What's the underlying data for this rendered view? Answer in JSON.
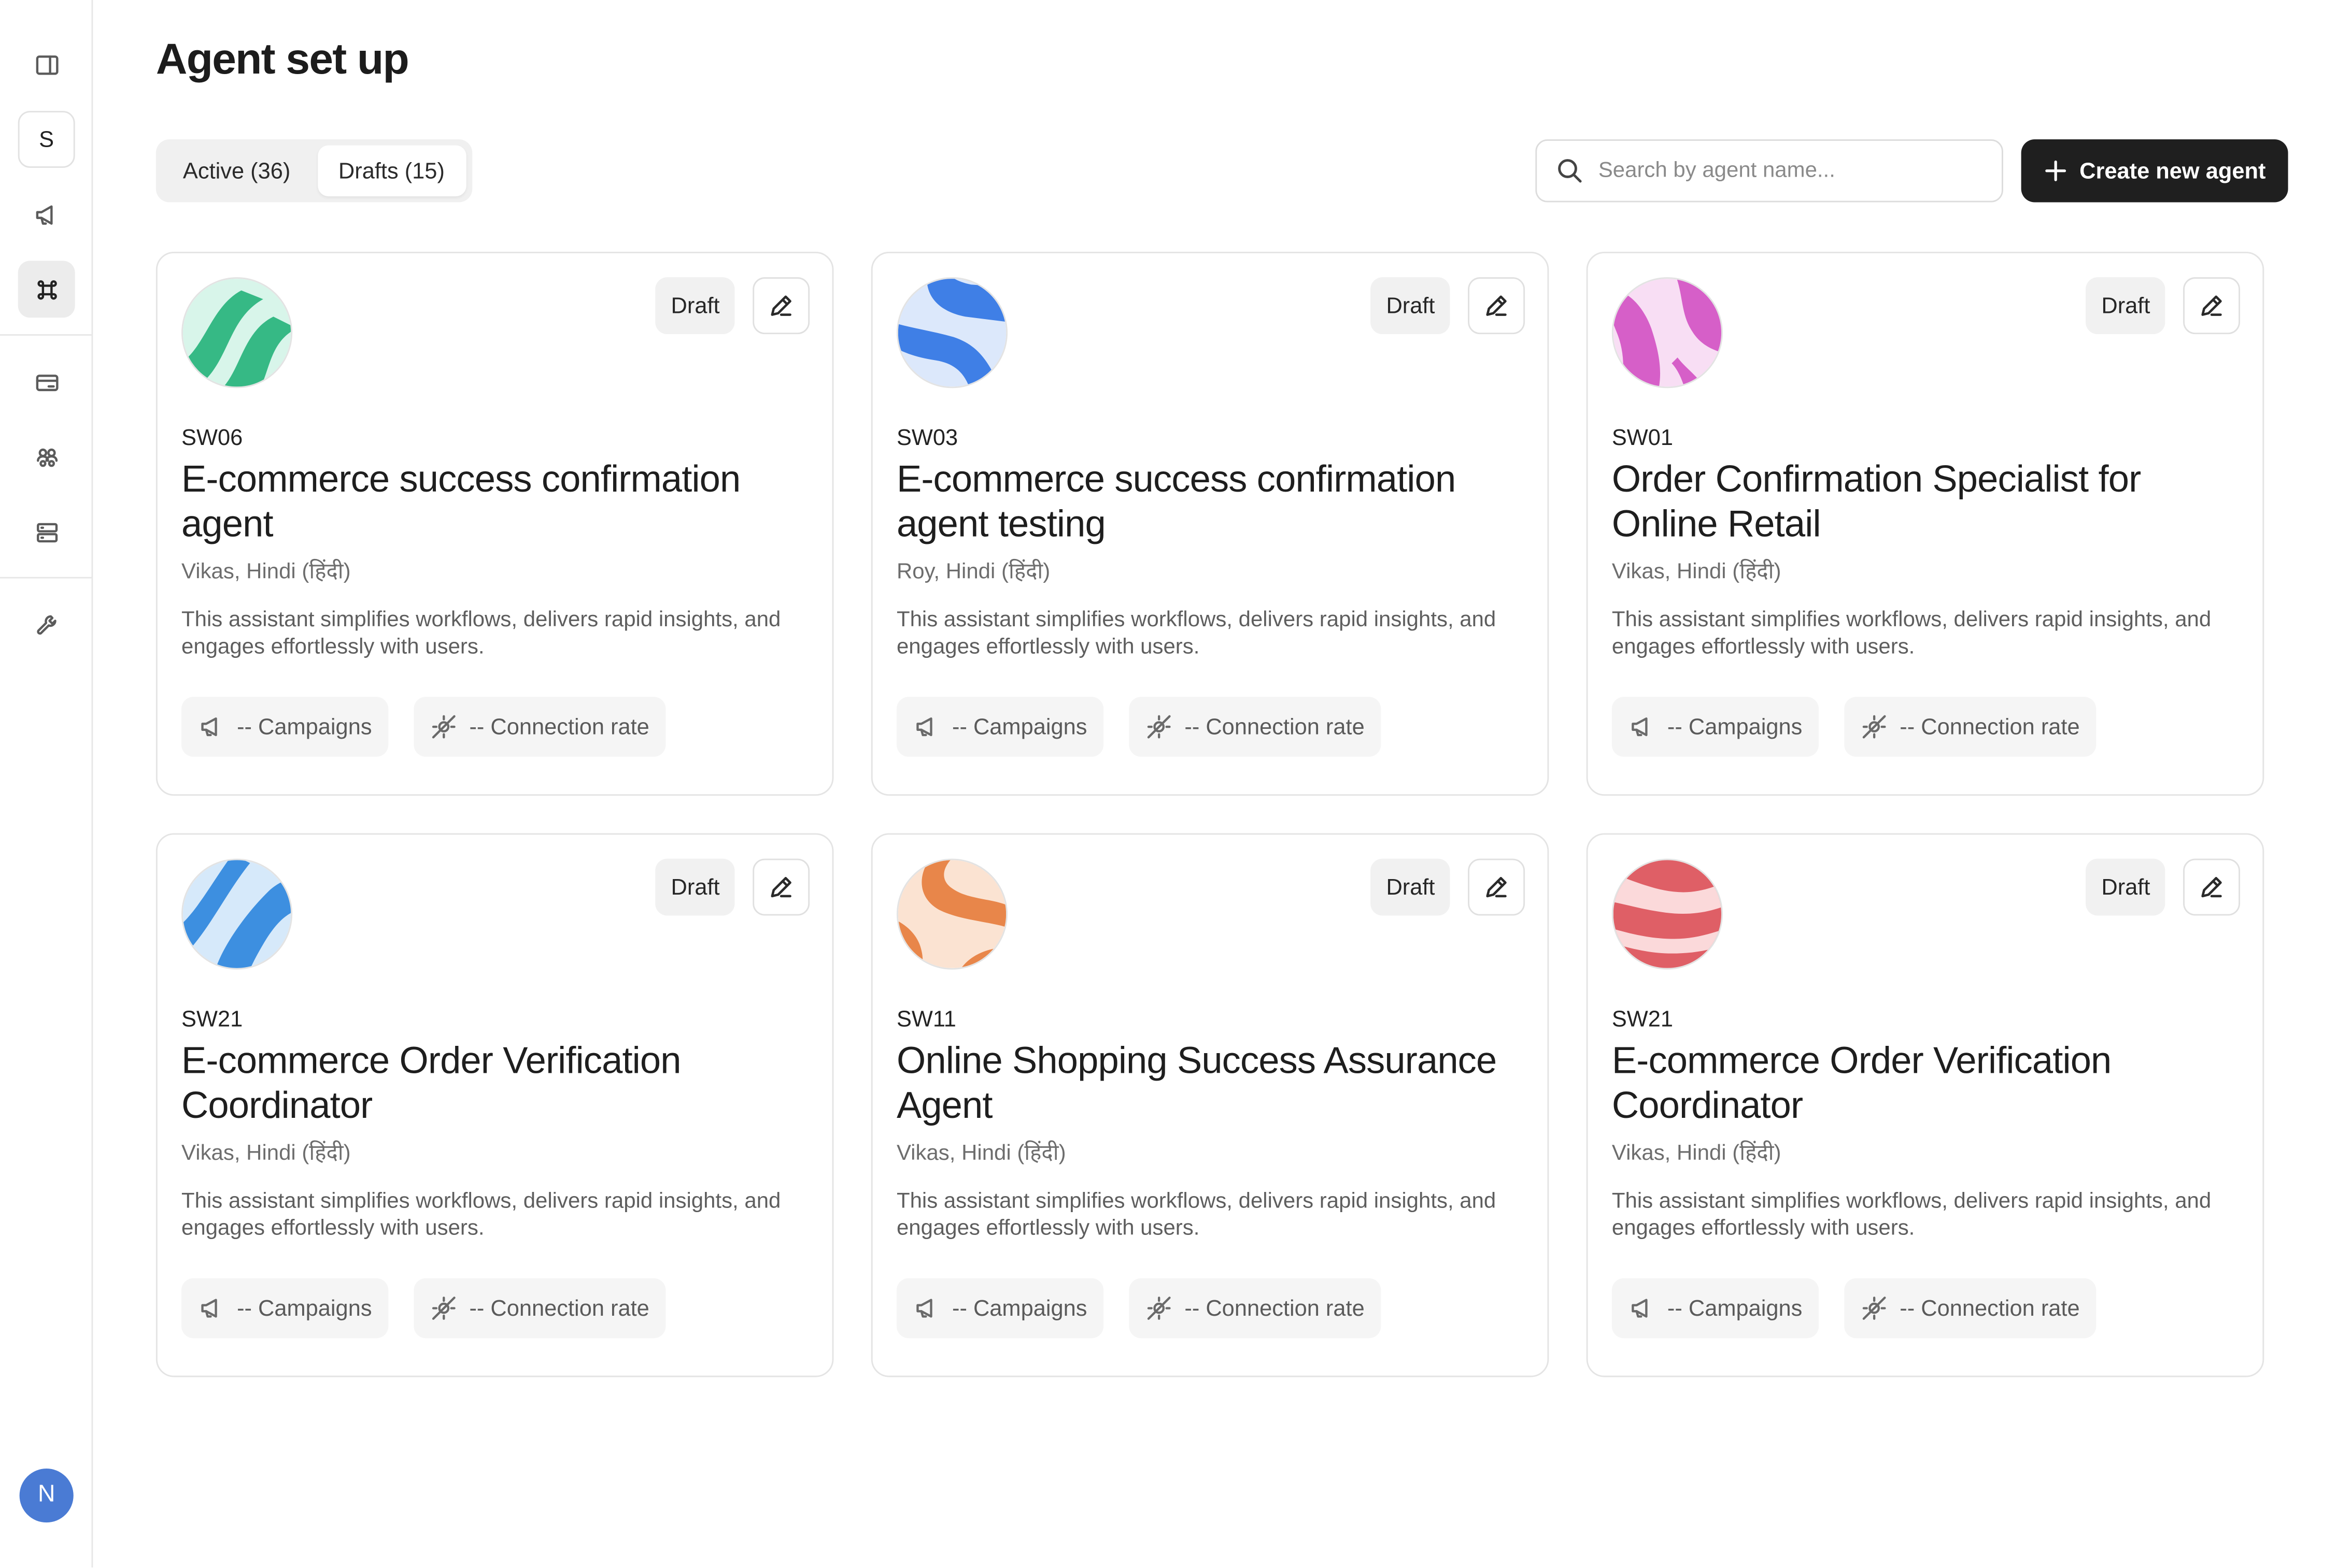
{
  "sidebar": {
    "workspace_initial": "S",
    "icons": [
      "panel-toggle-icon",
      "megaphone-icon",
      "command-icon",
      "card-icon",
      "users-icon",
      "server-icon",
      "wrench-icon"
    ],
    "user_initial": "N"
  },
  "header": {
    "title": "Agent set up",
    "tabs": [
      {
        "label": "Active (36)",
        "selected": false
      },
      {
        "label": "Drafts (15)",
        "selected": true
      }
    ],
    "search_placeholder": "Search by agent name...",
    "create_button": "Create new agent"
  },
  "colors": {
    "primary_button": "#1f1f1f",
    "user_avatar": "#4a7bd4"
  },
  "cards": [
    {
      "code": "SW06",
      "title": "E-commerce success confirmation agent",
      "voice": "Vikas, Hindi (हिंदी)",
      "description": "This assistant simplifies workflows, delivers rapid insights, and engages effortlessly with users.",
      "status": "Draft",
      "campaigns": "-- Campaigns",
      "connection_rate": "-- Connection rate",
      "avatar_colors": [
        "#36b985",
        "#d8f5ea"
      ]
    },
    {
      "code": "SW03",
      "title": "E-commerce success confirmation agent testing",
      "voice": "Roy, Hindi (हिंदी)",
      "description": "This assistant simplifies workflows, delivers rapid insights, and engages effortlessly with users.",
      "status": "Draft",
      "campaigns": "-- Campaigns",
      "connection_rate": "-- Connection rate",
      "avatar_colors": [
        "#3f7fe6",
        "#dce8fb"
      ]
    },
    {
      "code": "SW01",
      "title": "Order Confirmation Specialist for Online Retail",
      "voice": "Vikas, Hindi (हिंदी)",
      "description": "This assistant simplifies workflows, delivers rapid insights, and engages effortlessly with users.",
      "status": "Draft",
      "campaigns": "-- Campaigns",
      "connection_rate": "-- Connection rate",
      "avatar_colors": [
        "#d65fc8",
        "#f8def4"
      ]
    },
    {
      "code": "SW21",
      "title": "E-commerce Order Verification Coordinator",
      "voice": "Vikas, Hindi (हिंदी)",
      "description": "This assistant simplifies workflows, delivers rapid insights, and engages effortlessly with users.",
      "status": "Draft",
      "campaigns": "-- Campaigns",
      "connection_rate": "-- Connection rate",
      "avatar_colors": [
        "#3d8fe0",
        "#d6e9fa"
      ]
    },
    {
      "code": "SW11",
      "title": "Online Shopping Success Assurance Agent",
      "voice": "Vikas, Hindi (हिंदी)",
      "description": "This assistant simplifies workflows, delivers rapid insights, and engages effortlessly with users.",
      "status": "Draft",
      "campaigns": "-- Campaigns",
      "connection_rate": "-- Connection rate",
      "avatar_colors": [
        "#e8864a",
        "#fbe3d2"
      ]
    },
    {
      "code": "SW21",
      "title": "E-commerce Order Verification Coordinator",
      "voice": "Vikas, Hindi (हिंदी)",
      "description": "This assistant simplifies workflows, delivers rapid insights, and engages effortlessly with users.",
      "status": "Draft",
      "campaigns": "-- Campaigns",
      "connection_rate": "-- Connection rate",
      "avatar_colors": [
        "#df5f66",
        "#fbd9da"
      ]
    }
  ]
}
